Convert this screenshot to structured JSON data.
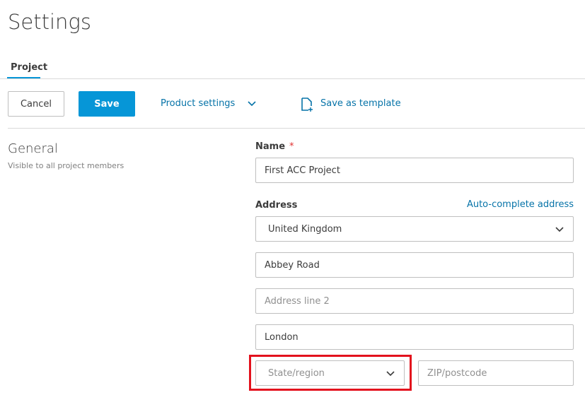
{
  "page": {
    "title": "Settings",
    "tab": "Project"
  },
  "toolbar": {
    "cancel": "Cancel",
    "save": "Save",
    "product_settings": "Product settings",
    "save_template": "Save as template"
  },
  "section": {
    "title": "General",
    "subtitle": "Visible to all project members"
  },
  "form": {
    "name_label": "Name",
    "required_mark": "*",
    "name_value": "First ACC Project",
    "address_label": "Address",
    "autocomplete": "Auto-complete address",
    "country": "United Kingdom",
    "line1": "Abbey Road",
    "line2_placeholder": "Address line 2",
    "city": "London",
    "state_placeholder": "State/region",
    "zip_placeholder": "ZIP/postcode"
  },
  "colors": {
    "accent": "#0696d7",
    "highlight": "#e3121d"
  }
}
